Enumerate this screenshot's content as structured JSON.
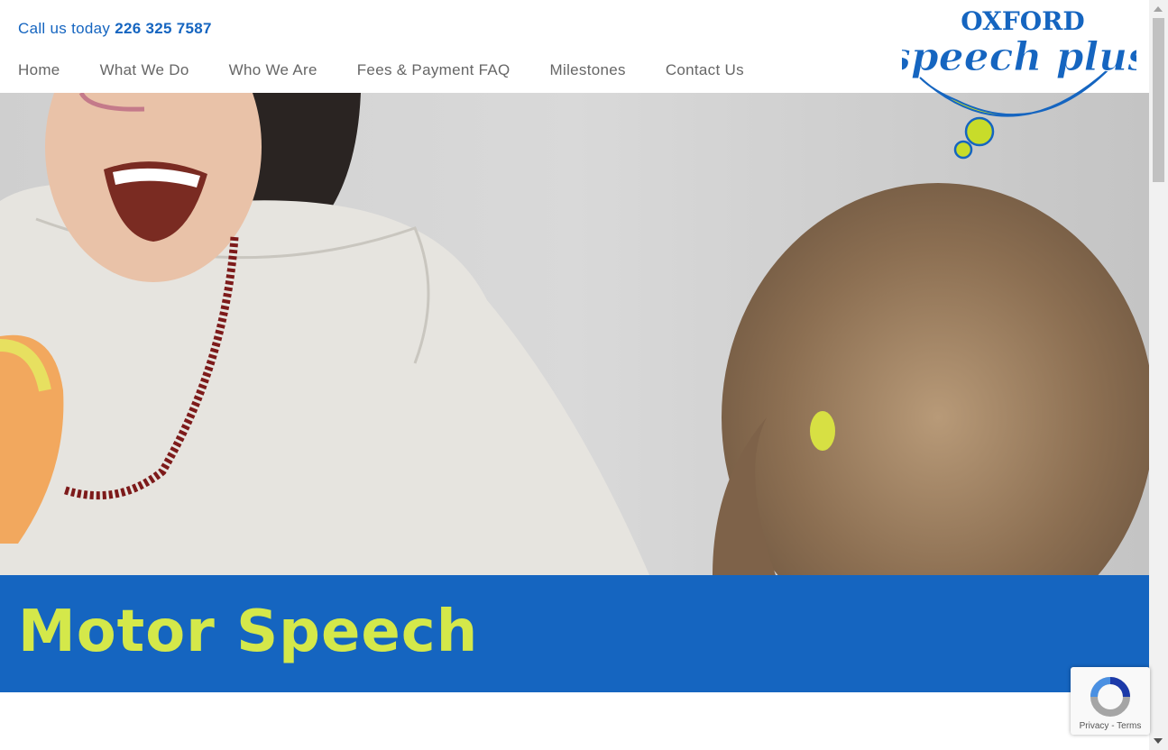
{
  "header": {
    "phone_prefix": "Call us today",
    "phone_number": "226 325 7587",
    "nav": [
      "Home",
      "What We Do",
      "Who We Are",
      "Fees & Payment FAQ",
      "Milestones",
      "Contact Us"
    ]
  },
  "logo": {
    "line1": "OXFORD",
    "line2": "speech plus"
  },
  "banner": {
    "title": "Motor Speech"
  },
  "recaptcha": {
    "privacy": "Privacy",
    "separator": " - ",
    "terms": "Terms"
  },
  "colors": {
    "brand_blue": "#1565c0",
    "brand_lime": "#d4e84a",
    "nav_text": "#666666"
  },
  "icons": {
    "recaptcha": "recaptcha-icon",
    "scroll_up": "scroll-up-arrow-icon",
    "scroll_down": "scroll-down-arrow-icon"
  }
}
